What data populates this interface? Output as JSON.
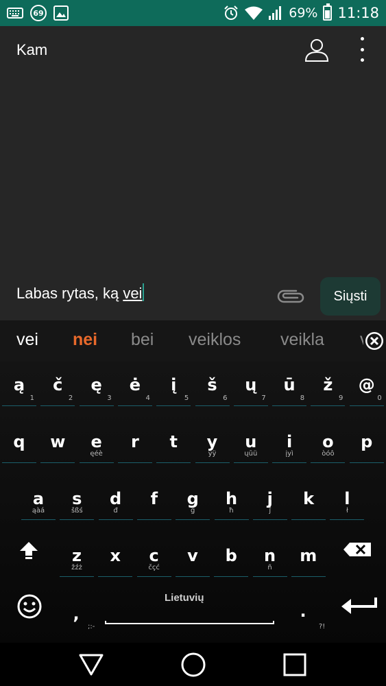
{
  "status_bar": {
    "notification_count": "69",
    "battery": "69%",
    "battery_level": 0.69,
    "time": "11:18",
    "icons": [
      "keyboard-icon",
      "notification-badge-icon",
      "image-icon",
      "alarm-icon",
      "wifi-icon",
      "signal-icon",
      "battery-icon"
    ]
  },
  "compose": {
    "to_label": "Kam",
    "message_text": "Labas rytas, ką ",
    "composing_word": "vei",
    "send_label": "Siųsti"
  },
  "suggestions": [
    {
      "text": "vei",
      "color": "#ffffff"
    },
    {
      "text": "nei",
      "color": "#e8692b"
    },
    {
      "text": "bei",
      "color": "#8a8a8a"
    },
    {
      "text": "veiklos",
      "color": "#8a8a8a"
    },
    {
      "text": "veikla",
      "color": "#8a8a8a"
    },
    {
      "text": "v",
      "color": "#8a8a8a"
    }
  ],
  "keyboard": {
    "row0": [
      {
        "key": "ą",
        "hint": "1"
      },
      {
        "key": "č",
        "hint": "2"
      },
      {
        "key": "ę",
        "hint": "3"
      },
      {
        "key": "ė",
        "hint": "4"
      },
      {
        "key": "į",
        "hint": "5"
      },
      {
        "key": "š",
        "hint": "6"
      },
      {
        "key": "ų",
        "hint": "7"
      },
      {
        "key": "ū",
        "hint": "8"
      },
      {
        "key": "ž",
        "hint": "9"
      },
      {
        "key": "@",
        "hint": "0"
      }
    ],
    "row1": [
      {
        "key": "q",
        "alt": ""
      },
      {
        "key": "w",
        "alt": ""
      },
      {
        "key": "e",
        "alt": "ęéè"
      },
      {
        "key": "r",
        "alt": ""
      },
      {
        "key": "t",
        "alt": ""
      },
      {
        "key": "y",
        "alt": "ýÿ"
      },
      {
        "key": "u",
        "alt": "ųūü"
      },
      {
        "key": "i",
        "alt": "įyì"
      },
      {
        "key": "o",
        "alt": "òóô"
      },
      {
        "key": "p",
        "alt": ""
      }
    ],
    "row2": [
      {
        "key": "a",
        "alt": "ąàá"
      },
      {
        "key": "s",
        "alt": "šßś"
      },
      {
        "key": "d",
        "alt": "đ"
      },
      {
        "key": "f",
        "alt": ""
      },
      {
        "key": "g",
        "alt": "ĝ"
      },
      {
        "key": "h",
        "alt": "ħ"
      },
      {
        "key": "j",
        "alt": "ĵ"
      },
      {
        "key": "k",
        "alt": ""
      },
      {
        "key": "l",
        "alt": "ł"
      }
    ],
    "row3": [
      {
        "key": "z",
        "alt": "žźż"
      },
      {
        "key": "x",
        "alt": ""
      },
      {
        "key": "c",
        "alt": "čçć"
      },
      {
        "key": "v",
        "alt": ""
      },
      {
        "key": "b",
        "alt": ""
      },
      {
        "key": "n",
        "alt": "ñ"
      },
      {
        "key": "m",
        "alt": ""
      }
    ],
    "comma": ",",
    "comma_hint": ";:-",
    "period": ".",
    "period_hint": "?!",
    "language": "Lietuvių"
  }
}
